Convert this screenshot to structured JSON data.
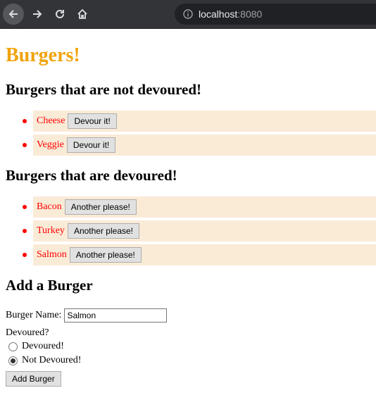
{
  "browser": {
    "url_host": "localhost",
    "url_port": ":8080",
    "icons": [
      "back-arrow-icon",
      "forward-arrow-icon",
      "reload-icon",
      "home-icon",
      "info-icon"
    ]
  },
  "page": {
    "title": "Burgers!",
    "undevoured_heading": "Burgers that are not devoured!",
    "devoured_heading": "Burgers that are devoured!",
    "add_heading": "Add a Burger"
  },
  "undevoured": [
    {
      "name": "Cheese",
      "button": "Devour it!"
    },
    {
      "name": "Veggie",
      "button": "Devour it!"
    }
  ],
  "devoured": [
    {
      "name": "Bacon",
      "button": "Another please!"
    },
    {
      "name": "Turkey",
      "button": "Another please!"
    },
    {
      "name": "Salmon",
      "button": "Another please!"
    }
  ],
  "form": {
    "name_label": "Burger Name:",
    "name_value": "Salmon",
    "devoured_label": "Devoured?",
    "option_devoured": "Devoured!",
    "option_not_devoured": "Not Devoured!",
    "selected": "Not Devoured!",
    "submit": "Add Burger"
  },
  "colors": {
    "title": "#f0a30a",
    "item_bg": "#faebd7",
    "item_text": "#ff0000",
    "toolbar": "#333437"
  }
}
